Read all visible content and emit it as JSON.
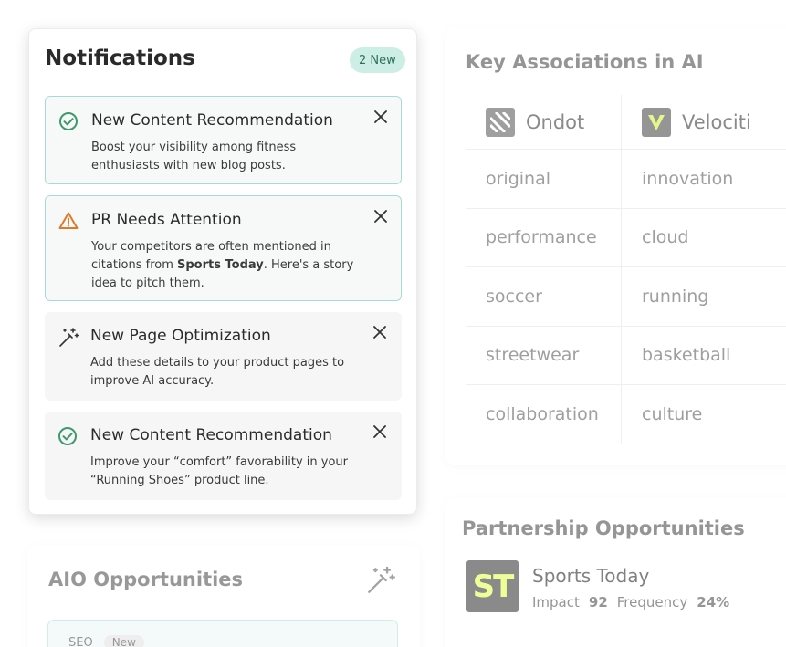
{
  "notifications": {
    "title": "Notifications",
    "badge": "2 New",
    "items": [
      {
        "icon": "check-circle-icon",
        "title": "New Content Recommendation",
        "body_line1": "Boost your visibility among fitness",
        "body_line2": "enthusiasts with new blog posts.",
        "highlighted": true
      },
      {
        "icon": "warning-triangle-icon",
        "title": "PR Needs Attention",
        "body_pre": "Your competitors are often mentioned in citations from ",
        "body_bold": "Sports Today",
        "body_post": ". Here's a story idea to pitch them.",
        "highlighted": true
      },
      {
        "icon": "magic-wand-icon",
        "title": "New Page Optimization",
        "body_line1": "Add these details to your product pages to",
        "body_line2": "improve AI accuracy.",
        "highlighted": false
      },
      {
        "icon": "check-circle-icon",
        "title": "New Content Recommendation",
        "body_line1": "Improve your “comfort” favorability in your",
        "body_line2": "“Running Shoes” product line.",
        "highlighted": false
      }
    ]
  },
  "key_associations": {
    "title": "Key Associations in AI",
    "brands": [
      "Ondot",
      "Velociti"
    ],
    "rows": [
      [
        "original",
        "innovation"
      ],
      [
        "performance",
        "cloud"
      ],
      [
        "soccer",
        "running"
      ],
      [
        "streetwear",
        "basketball"
      ],
      [
        "collaboration",
        "culture"
      ]
    ]
  },
  "partnership": {
    "title": "Partnership Opportunities",
    "partner_name": "Sports Today",
    "logo_text": "ST",
    "impact_label": "Impact",
    "impact_value": "92",
    "frequency_label": "Frequency",
    "frequency_value": "24%"
  },
  "aio": {
    "title": "AIO Opportunities",
    "tag": "SEO",
    "tag_badge": "New"
  },
  "colors": {
    "success": "#3d9a6a",
    "warning": "#e07a2a",
    "highlight_border": "#a8dcd3",
    "badge_bg": "#cdeee4"
  }
}
